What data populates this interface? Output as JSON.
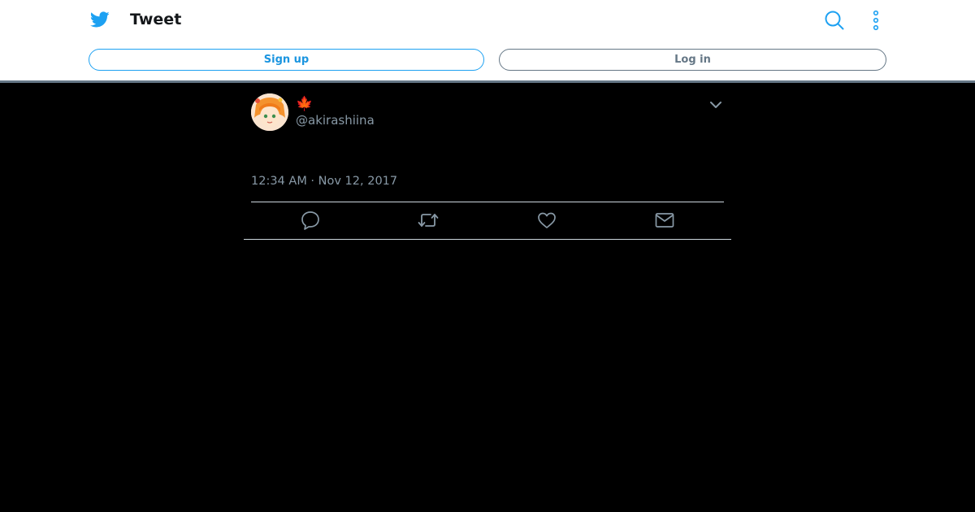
{
  "header": {
    "title": "Tweet",
    "signup_label": "Sign up",
    "login_label": "Log in"
  },
  "tweet": {
    "display_name": "🍁",
    "handle": "@akirashiina",
    "timestamp": "12:34 AM · Nov 12, 2017"
  },
  "icons": {
    "logo": "twitter-bird-icon",
    "search": "search-icon",
    "more": "more-vertical-icon",
    "caret": "chevron-down-icon",
    "reply": "reply-icon",
    "retweet": "retweet-icon",
    "like": "heart-icon",
    "message": "envelope-icon"
  },
  "colors": {
    "brand": "#1da1f2",
    "muted": "#8899a6",
    "background": "#000000"
  }
}
